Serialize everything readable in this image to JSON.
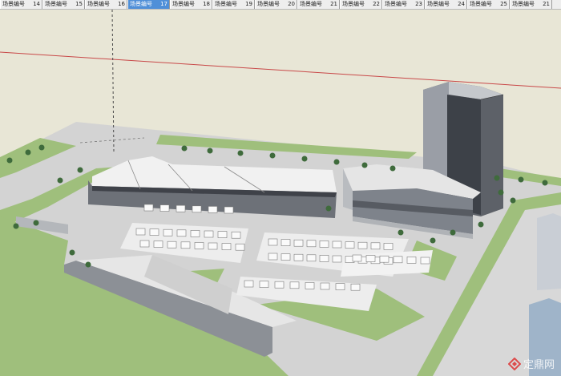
{
  "tabs": [
    {
      "label": "场景编号",
      "num": "14",
      "active": false
    },
    {
      "label": "场景编号",
      "num": "15",
      "active": false
    },
    {
      "label": "场景编号",
      "num": "16",
      "active": false
    },
    {
      "label": "场景编号",
      "num": "17",
      "active": true
    },
    {
      "label": "场景编号",
      "num": "18",
      "active": false
    },
    {
      "label": "场景编号",
      "num": "19",
      "active": false
    },
    {
      "label": "场景编号",
      "num": "20",
      "active": false
    },
    {
      "label": "场景编号",
      "num": "21",
      "active": false
    },
    {
      "label": "场景编号",
      "num": "22",
      "active": false
    },
    {
      "label": "场景编号",
      "num": "23",
      "active": false
    },
    {
      "label": "场景编号",
      "num": "24",
      "active": false
    },
    {
      "label": "场景编号",
      "num": "25",
      "active": false
    },
    {
      "label": "场景编号",
      "num": "21",
      "active": false
    }
  ],
  "watermark": {
    "text": "定鼎网",
    "logo": "dingding-logo-icon"
  },
  "colors": {
    "sky": "#e8e6d6",
    "ground": "#d3d3d3",
    "lawn": "#9fbf7c",
    "tab_active": "#4f8fd8",
    "axis_red": "#c84848"
  }
}
